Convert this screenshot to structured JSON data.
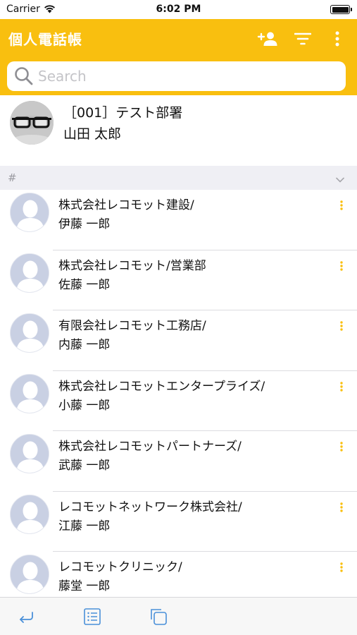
{
  "status_bar": {
    "carrier": "Carrier",
    "time": "6:02 PM"
  },
  "header": {
    "title": "個人電話帳",
    "search_placeholder": "Search"
  },
  "profile": {
    "department": "［001］テスト部署",
    "name": "山田 太郎"
  },
  "section": {
    "letter": "#"
  },
  "contacts": [
    {
      "company": "株式会社レコモット建設/",
      "name": "伊藤 一郎"
    },
    {
      "company": "株式会社レコモット/営業部",
      "name": "佐藤 一郎"
    },
    {
      "company": "有限会社レコモット工務店/",
      "name": "内藤 一郎"
    },
    {
      "company": "株式会社レコモットエンタープライズ/",
      "name": "小藤 一郎"
    },
    {
      "company": "株式会社レコモットパートナーズ/",
      "name": "武藤 一郎"
    },
    {
      "company": "レコモットネットワーク株式会社/",
      "name": "江藤 一郎"
    },
    {
      "company": "レコモットクリニック/",
      "name": "藤堂 一郎"
    }
  ],
  "colors": {
    "accent": "#f9bf0f",
    "toolbar_icon": "#4a90d9",
    "avatar": "#c9d0e3"
  },
  "icons": {
    "header": [
      "add-person-icon",
      "filter-icon",
      "more-vertical-icon"
    ],
    "toolbar": [
      "return-icon",
      "list-icon",
      "copy-icon"
    ]
  }
}
